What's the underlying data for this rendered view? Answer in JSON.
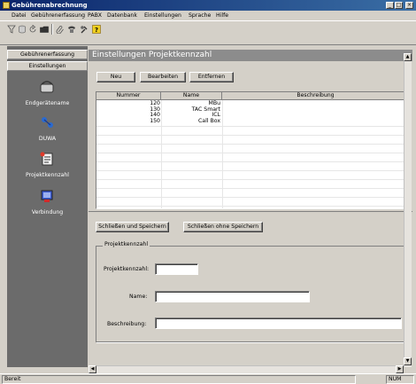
{
  "window": {
    "title": "Gebührenabrechnung",
    "controls": [
      "_",
      "□",
      "×"
    ]
  },
  "menu": [
    "Datei",
    "Gebührenerfassung",
    "PABX",
    "Datenbank",
    "Einstellungen",
    "Sprache",
    "Hilfe"
  ],
  "toolbar": {
    "icons": [
      "filter-icon",
      "database-icon",
      "refresh-icon",
      "folder-icon",
      "attach-icon",
      "phone-icon",
      "tools-icon",
      "help-icon"
    ]
  },
  "sidebar": {
    "sections": [
      "Gebührenerfassung",
      "Einstellungen"
    ],
    "items": [
      {
        "label": "Endgerätename",
        "icon": "phone-device-icon"
      },
      {
        "label": "DUWA",
        "icon": "network-icon"
      },
      {
        "label": "Projektkennzahl",
        "icon": "project-icon",
        "selected": true
      },
      {
        "label": "Verbindung",
        "icon": "connection-icon"
      }
    ]
  },
  "panel": {
    "title": "Einstellungen Projektkennzahl",
    "buttons": {
      "new": "Neu",
      "edit": "Bearbeiten",
      "delete": "Entfernen"
    }
  },
  "table": {
    "headers": [
      "Nummer",
      "Name",
      "Beschreibung"
    ],
    "rows": [
      {
        "nummer": "120",
        "name": "MBu",
        "beschreibung": ""
      },
      {
        "nummer": "130",
        "name": "TAC Smart",
        "beschreibung": ""
      },
      {
        "nummer": "140",
        "name": "ICL",
        "beschreibung": ""
      },
      {
        "nummer": "150",
        "name": "Call Box",
        "beschreibung": ""
      }
    ]
  },
  "form": {
    "save_close": "Schließen und Speichern",
    "close_nosave": "Schließen ohne Speichern",
    "group_title": "Projektkennzahl",
    "fields": {
      "projektkennzahl": {
        "label": "Projektkennzahl:",
        "value": ""
      },
      "name": {
        "label": "Name:",
        "value": ""
      },
      "beschreibung": {
        "label": "Beschreibung:",
        "value": ""
      }
    }
  },
  "status": {
    "left": "Bereit",
    "num": "NUM"
  }
}
